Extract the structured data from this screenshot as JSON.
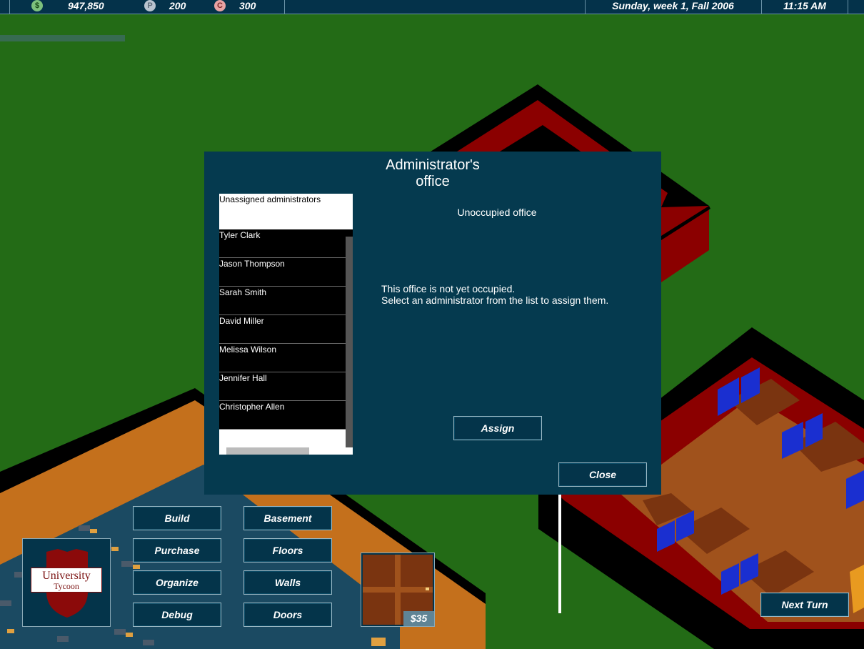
{
  "topbar": {
    "money": "947,850",
    "money_icon": "$",
    "prestige": "200",
    "prestige_icon": "P",
    "credits": "300",
    "credits_icon": "C",
    "date": "Sunday, week 1, Fall 2006",
    "time": "11:15 AM"
  },
  "dialog": {
    "title_line1": "Administrator's",
    "title_line2": "office",
    "list_header": "Unassigned administrators",
    "administrators": [
      "Tyler Clark",
      "Jason Thompson",
      "Sarah Smith",
      "David Miller",
      "Melissa Wilson",
      "Jennifer Hall",
      "Christopher Allen"
    ],
    "status": "Unoccupied office",
    "message_line1": "This office is not yet occupied.",
    "message_line2": "Select an administrator from the list to assign them.",
    "assign_label": "Assign",
    "close_label": "Close"
  },
  "toolbar": {
    "build": "Build",
    "basement": "Basement",
    "purchase": "Purchase",
    "floors": "Floors",
    "organize": "Organize",
    "walls": "Walls",
    "debug": "Debug",
    "doors": "Doors",
    "next_turn": "Next Turn"
  },
  "logo": {
    "line1": "University",
    "line2": "Tycoon"
  },
  "selected_item": {
    "price": "$35"
  },
  "colors": {
    "grass": "#236b16",
    "panel": "#053a4f",
    "wall_red": "#8b0000",
    "floor_wood": "#a0521c",
    "seat_blue": "#1a2fd0"
  }
}
